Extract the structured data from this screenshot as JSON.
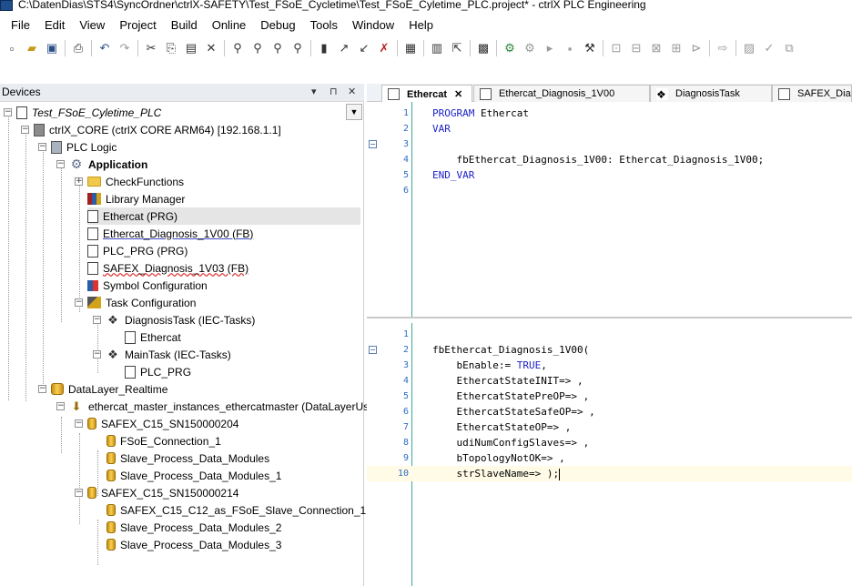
{
  "window": {
    "title": "C:\\DatenDias\\STS4\\SyncOrdner\\ctrlX-SAFETY\\Test_FSoE_Cycletime\\Test_FSoE_Cyletime_PLC.project* - ctrlX PLC Engineering"
  },
  "menu": [
    "File",
    "Edit",
    "View",
    "Project",
    "Build",
    "Online",
    "Debug",
    "Tools",
    "Window",
    "Help"
  ],
  "toolbar": {
    "icons": [
      "new-icon",
      "open-icon",
      "save-icon",
      "print-icon",
      "undo-icon",
      "redo-icon",
      "cut-icon",
      "copy-icon",
      "paste-icon",
      "delete-icon",
      "find-icon",
      "find-next-icon",
      "find-replace-icon",
      "bookmark-icon",
      "bookmark-next-icon",
      "login-icon",
      "logout-icon",
      "run-icon",
      "stop-icon",
      "breakpoint-icon"
    ]
  },
  "devices": {
    "header": "Devices",
    "controls": {
      "dropdown": "▾",
      "pin": "⊓",
      "close": "✕"
    },
    "tree": [
      {
        "label": "Test_FSoE_Cyletime_PLC",
        "icon": "project-icon",
        "expander": "−"
      },
      {
        "label": "ctrlX_CORE (ctrlX CORE ARM64) [192.168.1.1]",
        "icon": "device-icon",
        "expander": "−"
      },
      {
        "label": "PLC Logic",
        "icon": "plc-logic-icon",
        "expander": "−"
      },
      {
        "label": "Application",
        "icon": "gear-icon",
        "expander": "−"
      },
      {
        "label": "CheckFunctions",
        "icon": "folder-icon",
        "expander": "+"
      },
      {
        "label": "Library Manager",
        "icon": "library-icon",
        "expander": ""
      },
      {
        "label": "Ethercat (PRG)",
        "icon": "pou-icon",
        "expander": ""
      },
      {
        "label": "Ethercat_Diagnosis_1V00 (FB)",
        "icon": "pou-icon",
        "expander": ""
      },
      {
        "label": "PLC_PRG (PRG)",
        "icon": "pou-icon",
        "expander": ""
      },
      {
        "label": "SAFEX_Diagnosis_1V03 (FB)",
        "icon": "pou-icon",
        "expander": ""
      },
      {
        "label": "Symbol Configuration",
        "icon": "symbol-config-icon",
        "expander": ""
      },
      {
        "label": "Task Configuration",
        "icon": "task-config-icon",
        "expander": "−"
      },
      {
        "label": "DiagnosisTask (IEC-Tasks)",
        "icon": "task-icon",
        "expander": "−"
      },
      {
        "label": "Ethercat",
        "icon": "program-call-icon",
        "expander": ""
      },
      {
        "label": "MainTask (IEC-Tasks)",
        "icon": "task-icon",
        "expander": "−"
      },
      {
        "label": "PLC_PRG",
        "icon": "program-call-icon",
        "expander": ""
      },
      {
        "label": "DataLayer_Realtime",
        "icon": "datalayer-icon",
        "expander": "−"
      },
      {
        "label": "ethercat_master_instances_ethercatmaster (DataLayerUser)",
        "icon": "datalayer-user-icon",
        "expander": "−"
      },
      {
        "label": "SAFEX_C15_SN150000204",
        "icon": "data-node-icon",
        "expander": "−"
      },
      {
        "label": "FSoE_Connection_1",
        "icon": "data-node-icon",
        "expander": ""
      },
      {
        "label": "Slave_Process_Data_Modules",
        "icon": "data-node-icon",
        "expander": ""
      },
      {
        "label": "Slave_Process_Data_Modules_1",
        "icon": "data-node-icon",
        "expander": ""
      },
      {
        "label": "SAFEX_C15_SN150000214",
        "icon": "data-node-icon",
        "expander": "−"
      },
      {
        "label": "SAFEX_C15_C12_as_FSoE_Slave_Connection_1",
        "icon": "data-node-icon",
        "expander": ""
      },
      {
        "label": "Slave_Process_Data_Modules_2",
        "icon": "data-node-icon",
        "expander": ""
      },
      {
        "label": "Slave_Process_Data_Modules_3",
        "icon": "data-node-icon",
        "expander": ""
      }
    ]
  },
  "editor": {
    "tabs": [
      {
        "label": "Ethercat",
        "active": true,
        "close": "✕"
      },
      {
        "label": "Ethercat_Diagnosis_1V00",
        "active": false
      },
      {
        "label": "DiagnosisTask",
        "active": false
      },
      {
        "label": "SAFEX_Dia",
        "active": false
      }
    ],
    "declaration": [
      {
        "n": "1",
        "text": "PROGRAM Ethercat",
        "fold": ""
      },
      {
        "n": "2",
        "text": "VAR",
        "fold": ""
      },
      {
        "n": "3",
        "text": "",
        "fold": "−"
      },
      {
        "n": "4",
        "text": "    fbEthercat_Diagnosis_1V00: Ethercat_Diagnosis_1V00;",
        "fold": ""
      },
      {
        "n": "5",
        "text": "END_VAR",
        "fold": ""
      },
      {
        "n": "6",
        "text": "",
        "fold": ""
      }
    ],
    "implementation": [
      {
        "n": "1",
        "text": "",
        "fold": ""
      },
      {
        "n": "2",
        "text": "fbEthercat_Diagnosis_1V00(",
        "fold": "−"
      },
      {
        "n": "3",
        "text": "    bEnable:= TRUE,",
        "fold": ""
      },
      {
        "n": "4",
        "text": "    EthercatStateINIT=> ,",
        "fold": ""
      },
      {
        "n": "5",
        "text": "    EthercatStatePreOP=> ,",
        "fold": ""
      },
      {
        "n": "6",
        "text": "    EthercatStateSafeOP=> ,",
        "fold": ""
      },
      {
        "n": "7",
        "text": "    EthercatStateOP=> ,",
        "fold": ""
      },
      {
        "n": "8",
        "text": "    udiNumConfigSlaves=> ,",
        "fold": ""
      },
      {
        "n": "9",
        "text": "    bTopologyNotOK=> ,",
        "fold": ""
      },
      {
        "n": "10",
        "text": "    strSlaveName=> );",
        "fold": ""
      }
    ]
  }
}
